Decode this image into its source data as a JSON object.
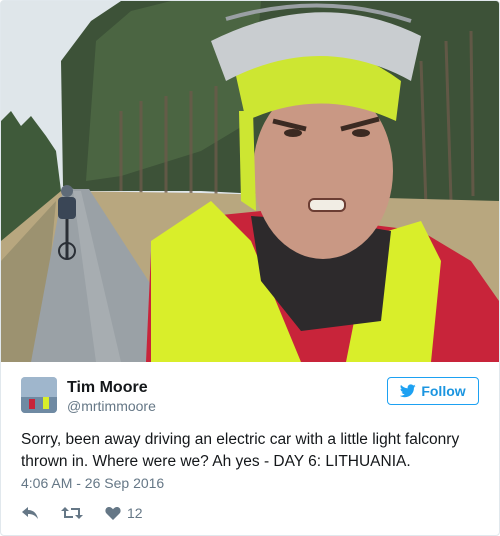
{
  "tweet": {
    "author_name": "Tim Moore",
    "author_handle": "@mrtimmoore",
    "follow_label": "Follow",
    "text": "Sorry, been away driving an electric car with a little light falconry thrown in. Where were we? Ah yes - DAY 6: LITHUANIA.",
    "timestamp": "4:06 AM - 26 Sep 2016",
    "like_count": "12"
  },
  "icons": {
    "follow": "bird-icon",
    "reply": "reply-icon",
    "retweet": "retweet-icon",
    "like": "heart-icon"
  },
  "colors": {
    "accent": "#1da1f2",
    "text": "#14171a",
    "muted": "#657786",
    "border": "#e1e8ed"
  }
}
